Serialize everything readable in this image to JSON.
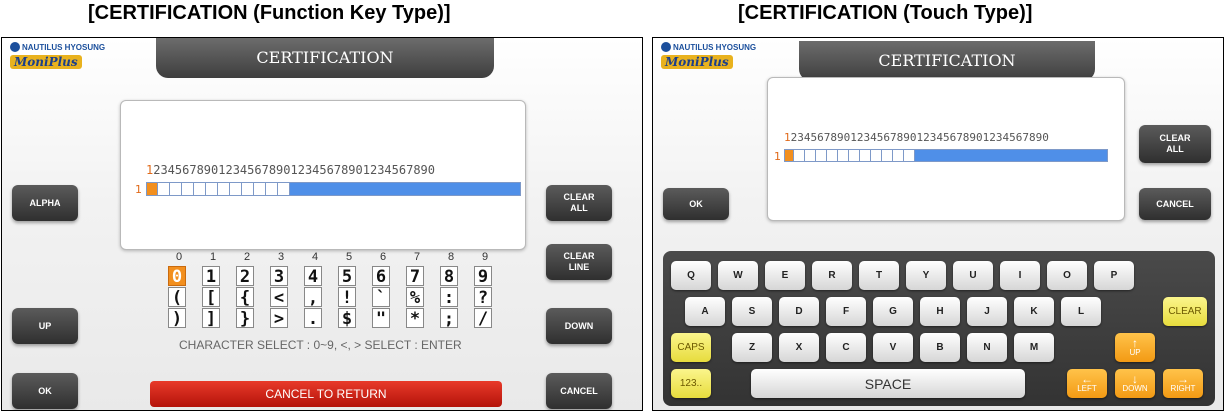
{
  "captions": {
    "left": "[CERTIFICATION (Function Key Type)]",
    "right": "[CERTIFICATION (Touch Type)]"
  },
  "logo": {
    "company": "NAUTILUS HYOSUNG",
    "product": "MoniPlus"
  },
  "colors": {
    "cursor": "#f28f1e",
    "field_blue": "#4f8fe8",
    "cancel_red": "#d4251a",
    "key_yellow": "#f0e85a",
    "key_orange": "#f6a623"
  },
  "function_key_screen": {
    "title": "CERTIFICATION",
    "ruler_first": "1",
    "ruler_rest": "234567890123456789012345678901234567890",
    "row_label": "1",
    "left_keys": {
      "alpha": "ALPHA",
      "up": "UP",
      "ok": "OK"
    },
    "right_keys": {
      "clear_all": "CLEAR\nALL",
      "clear_line": "CLEAR\nLINE",
      "down": "DOWN",
      "cancel": "CANCEL"
    },
    "char_indexes": [
      "0",
      "1",
      "2",
      "3",
      "4",
      "5",
      "6",
      "7",
      "8",
      "9"
    ],
    "char_rows": [
      [
        "0",
        "1",
        "2",
        "3",
        "4",
        "5",
        "6",
        "7",
        "8",
        "9"
      ],
      [
        "(",
        "[",
        "{",
        "<",
        ",",
        "!",
        "`",
        "%",
        ":",
        "?"
      ],
      [
        ")",
        "]",
        "}",
        ">",
        ".",
        "$",
        "\"",
        "*",
        ";",
        "/"
      ]
    ],
    "hint": "CHARACTER SELECT : 0~9, <, > SELECT : ENTER",
    "cancel_bar": "CANCEL TO RETURN"
  },
  "touch_screen": {
    "title": "CERTIFICATION",
    "ruler_first": "1",
    "ruler_rest": "234567890123456789012345678901234567890",
    "row_label": "1",
    "ok_key": "OK",
    "clear_all_key": "CLEAR\nALL",
    "cancel_key": "CANCEL",
    "keyboard": {
      "row1": [
        "Q",
        "W",
        "E",
        "R",
        "T",
        "Y",
        "U",
        "I",
        "O",
        "P"
      ],
      "row2": [
        "A",
        "S",
        "D",
        "F",
        "G",
        "H",
        "J",
        "K",
        "L"
      ],
      "row3": [
        "Z",
        "X",
        "C",
        "V",
        "B",
        "N",
        "M"
      ],
      "clear": "CLEAR",
      "caps": "CAPS",
      "num": "123..",
      "space": "SPACE",
      "up": "UP",
      "left": "LEFT",
      "down": "DOWN",
      "right": "RIGHT",
      "arrow_up": "↑",
      "arrow_left": "←",
      "arrow_down": "↓",
      "arrow_right": "→"
    }
  }
}
